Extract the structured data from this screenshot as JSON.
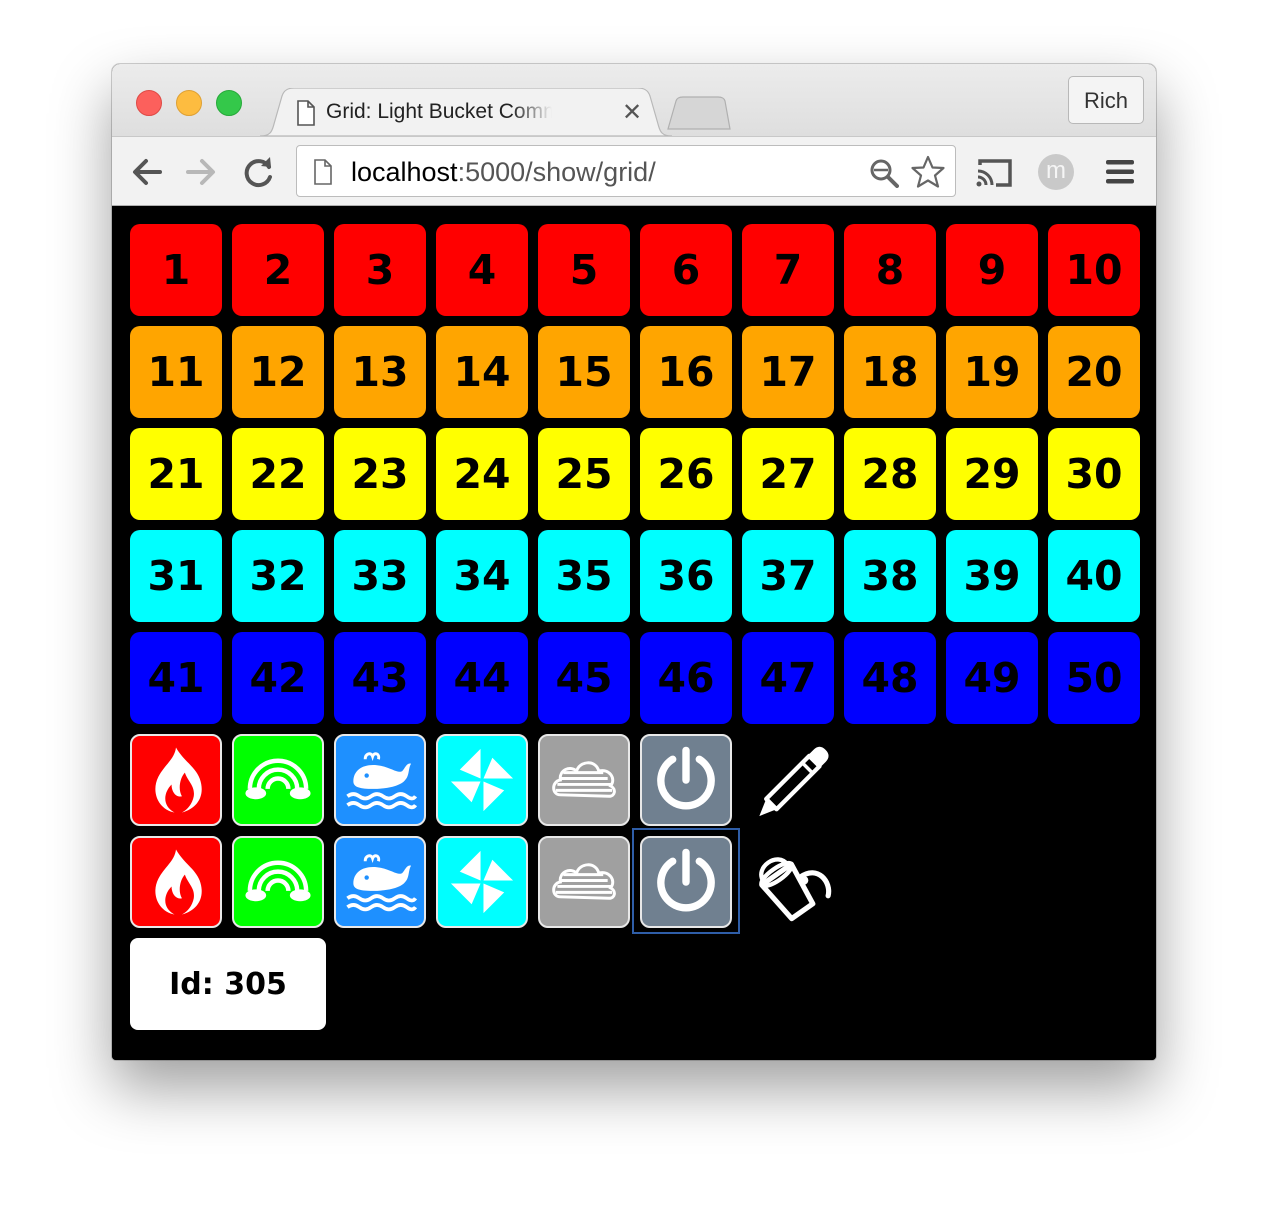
{
  "browser": {
    "tab_title": "Grid: Light Bucket Command Center",
    "url_host": "localhost",
    "url_path": ":5000/show/grid/",
    "profile_name": "Rich",
    "avatar_initial": "m"
  },
  "grid": {
    "rows": [
      {
        "color": "#ff0000",
        "labels": [
          "1",
          "2",
          "3",
          "4",
          "5",
          "6",
          "7",
          "8",
          "9",
          "10"
        ]
      },
      {
        "color": "#ffa500",
        "labels": [
          "11",
          "12",
          "13",
          "14",
          "15",
          "16",
          "17",
          "18",
          "19",
          "20"
        ]
      },
      {
        "color": "#ffff00",
        "labels": [
          "21",
          "22",
          "23",
          "24",
          "25",
          "26",
          "27",
          "28",
          "29",
          "30"
        ]
      },
      {
        "color": "#00ffff",
        "labels": [
          "31",
          "32",
          "33",
          "34",
          "35",
          "36",
          "37",
          "38",
          "39",
          "40"
        ]
      },
      {
        "color": "#0000ff",
        "labels": [
          "41",
          "42",
          "43",
          "44",
          "45",
          "46",
          "47",
          "48",
          "49",
          "50"
        ]
      }
    ]
  },
  "palette_rows": [
    {
      "tool_icon": "pencil-icon",
      "buttons": [
        {
          "icon": "fire-icon",
          "color": "#ff0000"
        },
        {
          "icon": "rainbow-icon",
          "color": "#00ff00"
        },
        {
          "icon": "whale-icon",
          "color": "#1e90ff"
        },
        {
          "icon": "pinwheel-icon",
          "color": "#00ffff"
        },
        {
          "icon": "cloud-icon",
          "color": "#a0a0a0"
        },
        {
          "icon": "power-icon",
          "color": "#708090"
        }
      ]
    },
    {
      "tool_icon": "paint-bucket-icon",
      "buttons": [
        {
          "icon": "fire-icon",
          "color": "#ff0000"
        },
        {
          "icon": "rainbow-icon",
          "color": "#00ff00"
        },
        {
          "icon": "whale-icon",
          "color": "#1e90ff"
        },
        {
          "icon": "pinwheel-icon",
          "color": "#00ffff"
        },
        {
          "icon": "cloud-icon",
          "color": "#a0a0a0"
        },
        {
          "icon": "power-icon",
          "color": "#708090"
        }
      ]
    }
  ],
  "selected": {
    "row": 1,
    "button": 5
  },
  "status": {
    "id_text": "Id: 305"
  }
}
